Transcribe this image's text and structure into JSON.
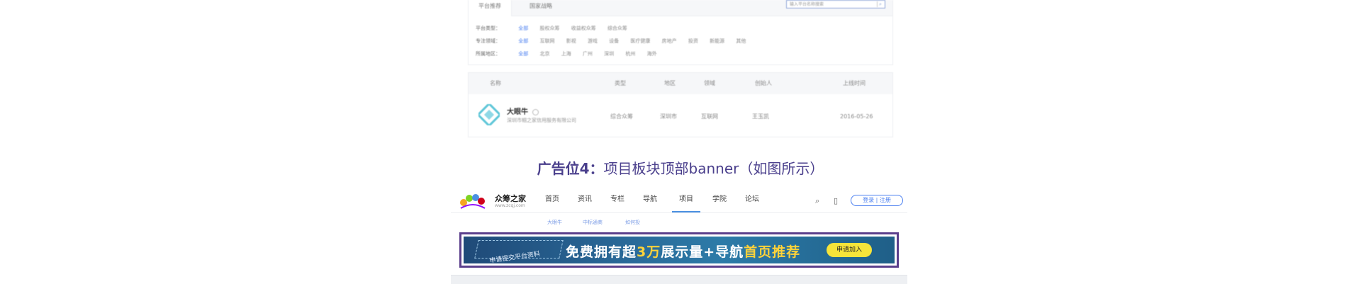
{
  "platform_panel": {
    "tabs": [
      "平台推荐",
      "国家战略"
    ],
    "search_placeholder": "输入平台名称搜索",
    "filters": [
      {
        "label": "平台类型：",
        "options": [
          "全部",
          "股权众筹",
          "收益权众筹",
          "综合众筹"
        ]
      },
      {
        "label": "专注领域：",
        "options": [
          "全部",
          "互联网",
          "影视",
          "游戏",
          "设备",
          "医疗健康",
          "房地产",
          "投资",
          "新能源",
          "其他"
        ]
      },
      {
        "label": "所属地区：",
        "options": [
          "全部",
          "北京",
          "上海",
          "广州",
          "深圳",
          "杭州",
          "海外"
        ]
      }
    ]
  },
  "table": {
    "headers": [
      "名称",
      "类型",
      "地区",
      "领域",
      "创始人",
      "上线时间"
    ],
    "row": {
      "name": "大眼牛",
      "company": "深圳市帼之家信用服务有限公司",
      "type": "综合众筹",
      "region": "深圳市",
      "field": "互联网",
      "founder": "王玉凯",
      "date": "2016-05-26"
    }
  },
  "heading": {
    "bold": "广告位4：",
    "rest": "项目板块顶部banner（如图所示）"
  },
  "site": {
    "brand_name": "众筹之家",
    "brand_url": "www.zcqj.com",
    "nav": [
      "首页",
      "资讯",
      "专栏",
      "导航",
      "项目",
      "学院",
      "论坛"
    ],
    "login_label": "登录 | 注册",
    "subnav": [
      "大眼牛",
      "中标通商",
      "如何投"
    ]
  },
  "banner": {
    "note": "申请提交平台资料",
    "main_prefix": "免费拥有超",
    "main_hl1": "3万",
    "main_mid": "展示量+导航",
    "main_hl2": "首页推荐",
    "cta": "申请加入"
  },
  "colors": {
    "accent": "#4a7ff0",
    "heading": "#4a3f8c",
    "banner_frame": "#5b3f8c",
    "banner_highlight": "#ffd23a",
    "cta": "#f6e43a"
  }
}
